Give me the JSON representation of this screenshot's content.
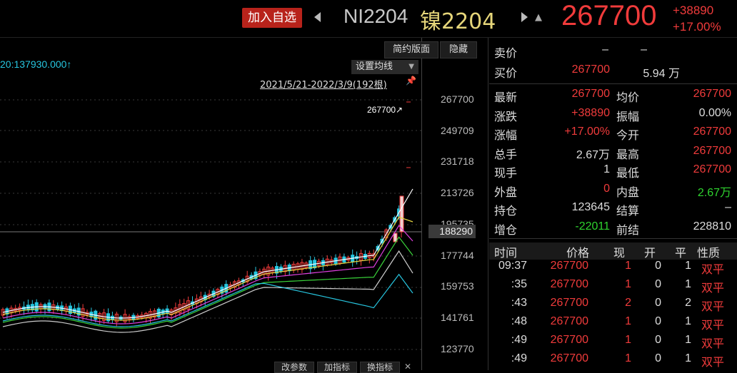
{
  "header": {
    "add_watchlist": "加入自选",
    "code": "NI2204",
    "name": "镍2204",
    "price": "267700",
    "change": "+38890",
    "change_pct": "+17.00%"
  },
  "chart": {
    "btn_simple": "简约版面",
    "btn_hide": "隐藏",
    "ma_label": "20:137930.000↑",
    "ma_settings": "设置均线",
    "range": "2021/5/21-2022/3/9(192根)",
    "max_label": "267700↗",
    "current_label": "188290",
    "y_ticks": [
      "267700",
      "249709",
      "231718",
      "213726",
      "195735",
      "177744",
      "159753",
      "141761",
      "123770"
    ],
    "bottom_buttons": [
      "改参数",
      "加指标",
      "换指标"
    ],
    "colors": {
      "up": "#f03b3b",
      "down": "#27c6e0",
      "ma5": "#ffffff",
      "ma10": "#e6d640",
      "ma20": "#e040e0",
      "ma30": "#3ad43a",
      "ma60": "#cccccc",
      "ma120": "#27c6e0"
    }
  },
  "quote": {
    "sell_label": "卖价",
    "sell_price": "–",
    "sell_vol": "–",
    "buy_label": "买价",
    "buy_price": "267700",
    "buy_vol": "5.94 万",
    "rows": [
      {
        "l1": "最新",
        "v1": "267700",
        "c1": "red",
        "l2": "均价",
        "v2": "267700",
        "c2": "red"
      },
      {
        "l1": "涨跌",
        "v1": "+38890",
        "c1": "red",
        "l2": "振幅",
        "v2": "0.00%",
        "c2": "white"
      },
      {
        "l1": "涨幅",
        "v1": "+17.00%",
        "c1": "red",
        "l2": "今开",
        "v2": "267700",
        "c2": "red"
      },
      {
        "l1": "总手",
        "v1": "2.67万",
        "c1": "white",
        "l2": "最高",
        "v2": "267700",
        "c2": "red"
      },
      {
        "l1": "现手",
        "v1": "1",
        "c1": "white",
        "l2": "最低",
        "v2": "267700",
        "c2": "red"
      },
      {
        "l1": "外盘",
        "v1": "0",
        "c1": "red",
        "l2": "内盘",
        "v2": "2.67万",
        "c2": "green"
      },
      {
        "l1": "持仓",
        "v1": "123645",
        "c1": "white",
        "l2": "结算",
        "v2": "–",
        "c2": "white"
      },
      {
        "l1": "增仓",
        "v1": "-22011",
        "c1": "green",
        "l2": "前结",
        "v2": "228810",
        "c2": "white"
      }
    ]
  },
  "trades": {
    "headers": [
      "时间",
      "价格",
      "现",
      "开",
      "平",
      "性质"
    ],
    "rows": [
      {
        "time": "09:37",
        "price": "267700",
        "now": "1",
        "open": "0",
        "close": "1",
        "nature": "双平"
      },
      {
        "time": ":35",
        "price": "267700",
        "now": "1",
        "open": "0",
        "close": "1",
        "nature": "双平"
      },
      {
        "time": ":43",
        "price": "267700",
        "now": "2",
        "open": "0",
        "close": "2",
        "nature": "双平"
      },
      {
        "time": ":48",
        "price": "267700",
        "now": "1",
        "open": "0",
        "close": "1",
        "nature": "双平"
      },
      {
        "time": ":49",
        "price": "267700",
        "now": "1",
        "open": "0",
        "close": "1",
        "nature": "双平"
      },
      {
        "time": ":49",
        "price": "267700",
        "now": "1",
        "open": "0",
        "close": "1",
        "nature": "双平"
      }
    ]
  }
}
